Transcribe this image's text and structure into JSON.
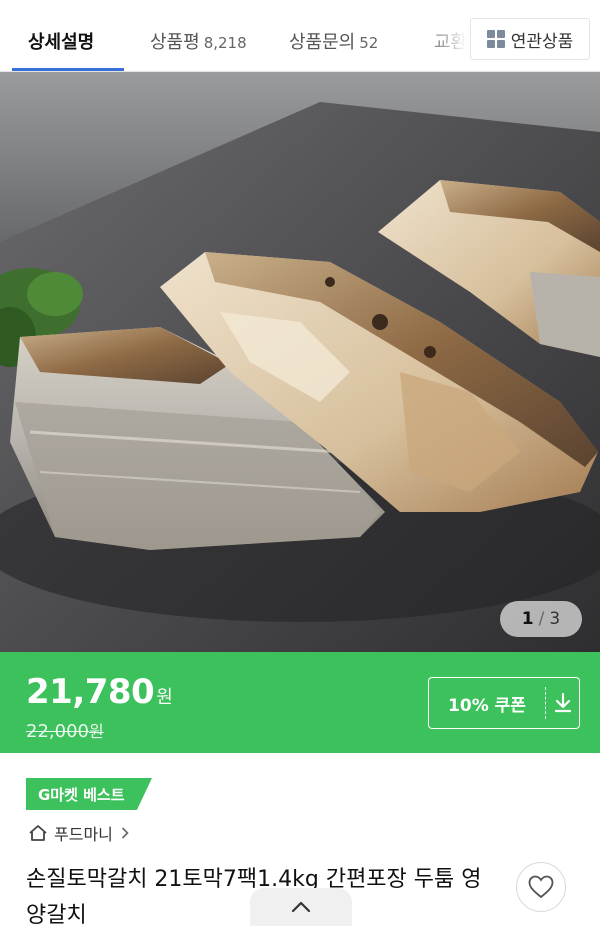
{
  "tabs": [
    {
      "label": "상세설명",
      "count": ""
    },
    {
      "label": "상품평",
      "count": "8,218"
    },
    {
      "label": "상품문의",
      "count": "52"
    },
    {
      "label": "교환",
      "count": ""
    }
  ],
  "related_label": "연관상품",
  "pager": {
    "current": "1",
    "separator": "/",
    "total": "3"
  },
  "price": {
    "amount": "21,780",
    "unit": "원",
    "original": "22,000",
    "original_unit": "원"
  },
  "coupon_label": "10% 쿠폰",
  "badge": "G마켓 베스트",
  "seller": "푸드마니",
  "title": "손질토막갈치 21토막7팩1.4kg 간편포장 두툼 영양갈치",
  "colors": {
    "accent_green": "#3dc15c",
    "tab_active": "#3a6fd8"
  },
  "icons": [
    "grid-icon",
    "download-icon",
    "home-icon",
    "chevron-right-icon",
    "heart-icon",
    "chevron-up-icon"
  ]
}
